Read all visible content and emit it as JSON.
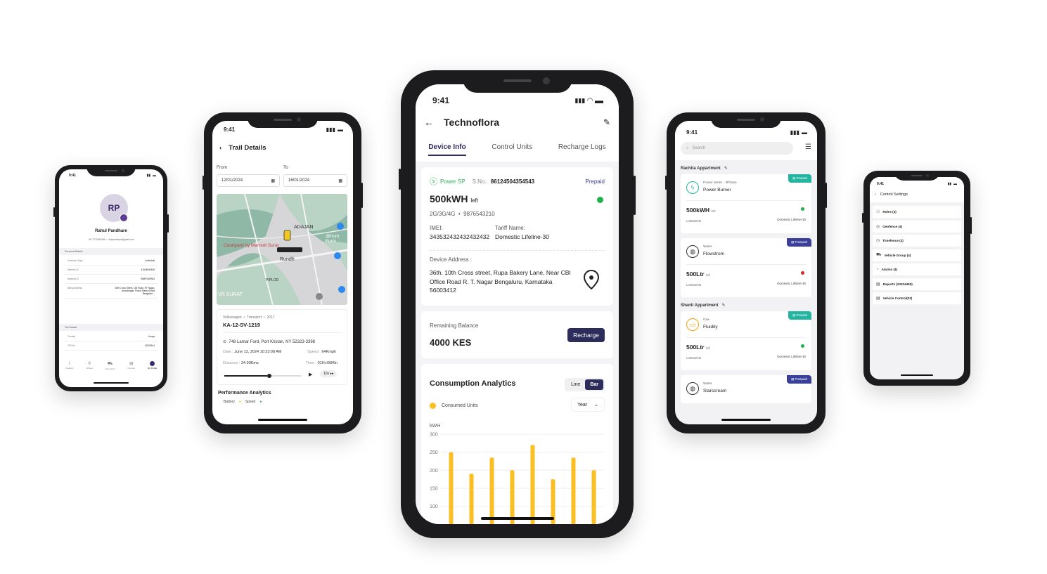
{
  "colors": {
    "brand": "#2c2d5a",
    "green": "#1fb14c",
    "red": "#e02424",
    "amber": "#fbbf24",
    "teal": "#22b5a1",
    "indigo": "#3a3f9a"
  },
  "status_time": "9:41",
  "profile": {
    "initials": "RP",
    "name": "Rahul Pandhare",
    "phone": "+91 7373044484",
    "email": "rhulpandhare@gmail.com",
    "personal_details_title": "Personal Details",
    "personal": [
      {
        "label": "Customer Type",
        "value": "Individual"
      },
      {
        "label": "Member ID",
        "value": "41534592456"
      },
      {
        "label": "National ID",
        "value": "98WF2W3WJ"
      },
      {
        "label": "Billing Address",
        "value": "36th Cross Street, CBI Road, RT Nagar, Anandnagar, Police Station Road Bengaluru..."
      }
    ],
    "tax_details_title": "Tax Details",
    "tax": [
      {
        "label": "Country",
        "value": "Kenya"
      },
      {
        "label": "CRI No",
        "value": "126025AJ"
      }
    ],
    "tabs": [
      "Analytics",
      "Utilities",
      "Telematics",
      "Invoices",
      "My Profile"
    ]
  },
  "trail": {
    "title": "Trail Details",
    "from_label": "From",
    "to_label": "To",
    "from_date": "12/01/2024",
    "to_date": "16/01/2024",
    "map_labels": [
      "ADAJAN",
      "Courtyard by Marriott Surat",
      "Rundh",
      "PIPLOD",
      "VR SURAT",
      "@hom Furni"
    ],
    "vehicle_meta": [
      "Volkswagen",
      "Transport",
      "2017"
    ],
    "plate": "KA-12-SV-1219",
    "address": "748 Lamar Ford, Port Kristan, NY 52323-3398",
    "date_label": "Date :",
    "date_value": "June 12, 2024 10:23:08 AM",
    "speed_label": "Speed :",
    "speed_value": "64Kmph",
    "distance_label": "Distance :",
    "distance_value": "34.90Kms",
    "time_label": "Time :",
    "time_value": "01Hr:06Min",
    "playback_speed": "10x",
    "playback_progress": 0.55,
    "perf_title": "Performance Analytics",
    "perf_legend": [
      "Battery",
      "Speed"
    ]
  },
  "device": {
    "title": "Technoflora",
    "tabs": [
      "Device Info",
      "Control Units",
      "Recharge Logs"
    ],
    "active_tab": 0,
    "meter_type": "Power SP",
    "sno_label": "S.No.:",
    "sno_value": "86124504354543",
    "plan": "Prepaid",
    "units": "500kWH",
    "units_suffix": "left",
    "network": "2G/3G/4G",
    "phone": "9876543210",
    "imei_label": "IMEI:",
    "imei_value": "343532432432432432",
    "tariff_label": "Tariff Name:",
    "tariff_value": "Domestic Lifeline-30",
    "address_label": "Device Address :",
    "address_value": "36th, 10th Cross street, Rupa Bakery Lane, Near CBI Office Road R. T. Nagar Bengaluru, Karnataka 56003412",
    "balance_label": "Remaining Balance",
    "balance_value": "4000 KES",
    "recharge_label": "Recharge",
    "analytics_title": "Consumption Analytics",
    "toggle": [
      "Line",
      "Bar"
    ],
    "toggle_active": 1,
    "legend": "Consumed Units",
    "period": "Year"
  },
  "chart_data": {
    "type": "bar",
    "ylabel": "kWH",
    "yticks": [
      100,
      150,
      200,
      250,
      300
    ],
    "ylim": [
      70,
      300
    ],
    "values": [
      250,
      190,
      235,
      200,
      270,
      175,
      235,
      200
    ],
    "grid": true,
    "color": "#fbbf24"
  },
  "list": {
    "search_placeholder": "Search",
    "groups": [
      {
        "name": "Rachita Appartment",
        "items": [
          {
            "tag": "Prepaid",
            "tag_kind": "pre",
            "icon": "bolt-icon",
            "type": "Power Meter - 3Phase",
            "name": "Power Burner",
            "amount": "500kWH",
            "suffix": "left",
            "status": "green",
            "network": "LoRaWAN",
            "tariff": "Domestic Lifeline-30"
          },
          {
            "tag": "Postpaid",
            "tag_kind": "post",
            "icon": "water-icon",
            "type": "Water",
            "name": "Flowstrom",
            "amount": "500Ltr",
            "suffix": "left",
            "status": "red",
            "network": "LoRaWAN",
            "tariff": "Domestic Lifeline-30"
          }
        ]
      },
      {
        "name": "Shanti Appartment",
        "items": [
          {
            "tag": "Prepaid",
            "tag_kind": "pre",
            "icon": "gas-icon",
            "type": "Gas",
            "name": "Fluidity",
            "amount": "500Ltr",
            "suffix": "left",
            "status": "green",
            "network": "LoRaWAN",
            "tariff": "Domestic Lifeline-30"
          },
          {
            "tag": "Postpaid",
            "tag_kind": "post",
            "icon": "water-icon",
            "type": "Water",
            "name": "Starscream"
          }
        ]
      }
    ]
  },
  "control": {
    "title": "Control Settings",
    "items": [
      "Roles (4)",
      "Geofence (4)",
      "Timefence (4)",
      "Vehicle Group (4)",
      "Alarms (4)",
      "Reports (24324455)",
      "Vehicle Control(02)"
    ]
  }
}
